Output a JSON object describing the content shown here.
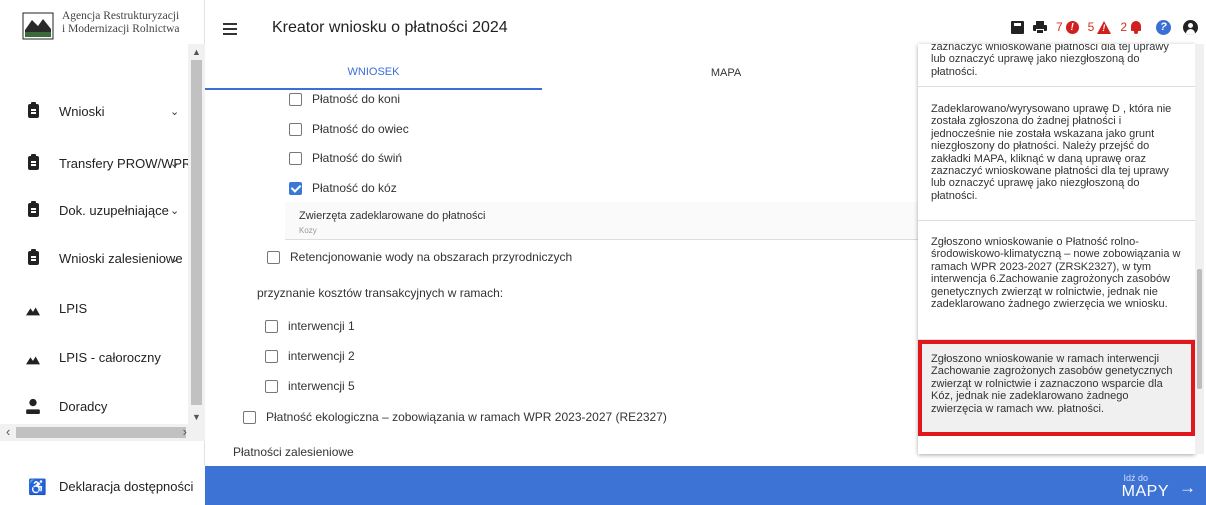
{
  "sidebar": {
    "logo_text_line1": "Agencja Restrukturyzacji",
    "logo_text_line2": "i Modernizacji Rolnictwa",
    "items": [
      {
        "label": "Wnioski",
        "icon": "clipboard-icon",
        "chevron": "⌄"
      },
      {
        "label": "Transfery PROW/WPR",
        "icon": "clipboard-icon",
        "chevron": "⌄"
      },
      {
        "label": "Dok. uzupełniające",
        "icon": "clipboard-icon",
        "chevron": "⌄"
      },
      {
        "label": "Wnioski zalesieniowe",
        "icon": "clipboard-icon",
        "chevron": "⌄"
      },
      {
        "label": "LPIS",
        "icon": "mountain-icon",
        "chevron": ""
      },
      {
        "label": "LPIS - całoroczny",
        "icon": "mountain-icon",
        "chevron": ""
      },
      {
        "label": "Doradcy",
        "icon": "person-icon",
        "chevron": ""
      }
    ],
    "accessibility_label": "Deklaracja dostępności"
  },
  "header": {
    "title": "Kreator wniosku o płatności 2024",
    "tabs": {
      "wniosek": "WNIOSEK",
      "mapa": "MAPA"
    },
    "counts": {
      "errors": "7",
      "warnings": "5",
      "notifications": "2"
    },
    "colors": {
      "accent": "#3a6fd8",
      "alert": "#d02020"
    }
  },
  "form": {
    "konie": "Płatność do koni",
    "owce": "Płatność do owiec",
    "swinie": "Płatność do świń",
    "kozy": "Płatność do kóz",
    "animals_label": "Zwierzęta zadeklarowane do płatności",
    "animals_value": "Kozy",
    "retencja": "Retencjonowanie wody na obszarach przyrodniczych",
    "koszty_title": "przyznanie kosztów transakcyjnych w ramach:",
    "int1": "interwencji 1",
    "int2": "interwencji 2",
    "int5": "interwencji 5",
    "ekologiczna": "Płatność ekologiczna – zobowiązania w ramach WPR 2023-2027 (RE2327)",
    "zalesieniowe": "Płatności zalesieniowe"
  },
  "footer": {
    "idz": "Idź do",
    "mapy": "MAPY"
  },
  "notifications": [
    "zaznaczyć wnioskowane płatności dla tej uprawy lub oznaczyć uprawę jako niezgłoszoną do płatności.",
    "Zadeklarowano/wyrysowano uprawę D , która nie została zgłoszona do żadnej płatności i jednocześnie nie została wskazana jako grunt niezgłoszony do płatności. Należy przejść do zakładki MAPA, kliknąć w daną uprawę oraz zaznaczyć wnioskowane płatności dla tej uprawy lub oznaczyć uprawę jako niezgłoszoną do płatności.",
    "Zgłoszono wnioskowanie o Płatność rolno-środowiskowo-klimatyczną – nowe zobowiązania w ramach WPR 2023-2027 (ZRSK2327), w tym interwencja 6.Zachowanie zagrożonych zasobów genetycznych zwierząt w rolnictwie, jednak nie zadeklarowano żadnego zwierzęcia we wniosku.",
    "Zgłoszono wnioskowanie w ramach interwencji Zachowanie zagrożonych zasobów genetycznych zwierząt w rolnictwie i zaznaczono wsparcie dla Kóz, jednak nie zadeklarowano żadnego zwierzęcia w ramach ww. płatności."
  ]
}
